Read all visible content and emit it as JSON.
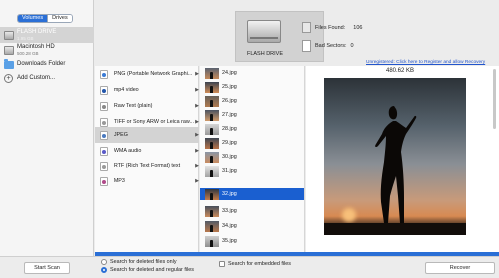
{
  "sidebar": {
    "tabs": [
      "Volumes",
      "Drives"
    ],
    "items": [
      {
        "label": "FLASH DRIVE",
        "sub": "1.95 GB",
        "icon": "hard-drive-icon"
      },
      {
        "label": "Macintosh HD",
        "sub": "500.28 GB",
        "icon": "hard-drive-icon"
      },
      {
        "label": "Downloads Folder",
        "icon": "folder-icon"
      },
      {
        "label": "Add Custom...",
        "icon": "plus-icon"
      }
    ]
  },
  "header": {
    "drive_label": "FLASH DRIVE",
    "files_found_label": "Files Found:",
    "files_found_value": "106",
    "bad_sectors_label": "Bad Sectors:",
    "bad_sectors_value": "0",
    "register_link": "Unregistered: Click here to Register and allow Recovery"
  },
  "formats": [
    {
      "label": "PNG (Portable Network Graphi...",
      "color": "#3a7bd5"
    },
    {
      "label": "mp4 video",
      "color": "#2255aa"
    },
    {
      "label": "Raw Text (plain)",
      "color": "#888888"
    },
    {
      "label": "TIFF or Sony ARW or Leica raw...",
      "color": "#999999"
    },
    {
      "label": "JPEG",
      "color": "#4a7ac0"
    },
    {
      "label": "WMA audio",
      "color": "#5a5ac8"
    },
    {
      "label": "RTF (Rich Text Format) text",
      "color": "#999999"
    },
    {
      "label": "MP3",
      "color": "#b04a8a"
    }
  ],
  "files": [
    "24.jpg",
    "25.jpg",
    "26.jpg",
    "27.jpg",
    "28.jpg",
    "29.jpg",
    "30.jpg",
    "31.jpg",
    "32.jpg",
    "33.jpg",
    "34.jpg",
    "35.jpg"
  ],
  "selected_file": "32.jpg",
  "preview": {
    "size": "480.62 KB"
  },
  "bottom": {
    "start_scan": "Start Scan",
    "opt_deleted_only": "Search for deleted files only",
    "opt_deleted_regular": "Search for deleted and regular files",
    "opt_embedded": "Search for embedded files",
    "recover": "Recover"
  },
  "progress": {
    "fraction": 1.0
  },
  "colors": {
    "accent": "#2a6fd6",
    "selection": "#1a5fd0"
  }
}
